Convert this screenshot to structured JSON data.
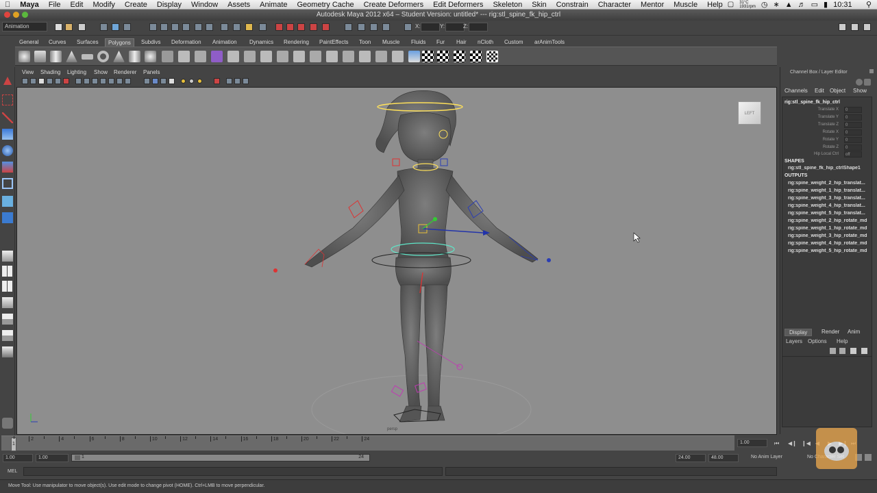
{
  "mac_menubar": {
    "app": "Maya",
    "items": [
      "File",
      "Edit",
      "Modify",
      "Create",
      "Display",
      "Window",
      "Assets",
      "Animate",
      "Geometry Cache",
      "Create Deformers",
      "Edit Deformers",
      "Skeleton",
      "Skin",
      "Constrain",
      "Character",
      "Mentor",
      "Muscle",
      "Help"
    ],
    "cpu_temp": "31°C",
    "cpu_rpm": "1931rpm",
    "clock": "Sat 10:31 AM"
  },
  "window": {
    "title": "Autodesk Maya 2012 x64 – Student Version: untitled*   ---   rig:stl_spine_fk_hip_ctrl"
  },
  "statusline": {
    "menu_set": "Animation",
    "x_label": "X:",
    "y_label": "Y:",
    "z_label": "Z:"
  },
  "shelf": {
    "tabs": [
      "General",
      "Curves",
      "Surfaces",
      "Polygons",
      "Subdivs",
      "Deformation",
      "Animation",
      "Dynamics",
      "Rendering",
      "PaintEffects",
      "Toon",
      "Muscle",
      "Fluids",
      "Fur",
      "Hair",
      "nCloth",
      "Custom",
      "arAnimTools"
    ],
    "active_tab": "Polygons"
  },
  "viewport": {
    "menu": [
      "View",
      "Shading",
      "Lighting",
      "Show",
      "Renderer",
      "Panels"
    ],
    "camera_label": "persp",
    "viewcube_label": "LEFT"
  },
  "channel_box": {
    "title": "Channel Box / Layer Editor",
    "menu": [
      "Channels",
      "Edit",
      "Object",
      "Show"
    ],
    "object_name": "rig:stl_spine_fk_hip_ctrl",
    "attributes": [
      {
        "name": "Translate X",
        "value": "0"
      },
      {
        "name": "Translate Y",
        "value": "0"
      },
      {
        "name": "Translate Z",
        "value": "0"
      },
      {
        "name": "Rotate X",
        "value": "0"
      },
      {
        "name": "Rotate Y",
        "value": "0"
      },
      {
        "name": "Rotate Z",
        "value": "0"
      },
      {
        "name": "Hip Local Ctrl",
        "value": "off"
      }
    ],
    "shapes_header": "SHAPES",
    "shapes": [
      "rig:stl_spine_fk_hip_ctrlShape1"
    ],
    "outputs_header": "OUTPUTS",
    "outputs": [
      "rig:spine_weight_2_hip_translat...",
      "rig:spine_weight_1_hip_translat...",
      "rig:spine_weight_3_hip_translat...",
      "rig:spine_weight_4_hip_translat...",
      "rig:spine_weight_5_hip_translat...",
      "rig:spine_weight_2_hip_rotate_md",
      "rig:spine_weight_1_hip_rotate_md",
      "rig:spine_weight_3_hip_rotate_md",
      "rig:spine_weight_4_hip_rotate_md",
      "rig:spine_weight_5_hip_rotate_md"
    ]
  },
  "layer_editor": {
    "tabs": [
      "Display",
      "Render",
      "Anim"
    ],
    "menu": [
      "Layers",
      "Options",
      "Help"
    ]
  },
  "timeline": {
    "ticks": [
      "2",
      "4",
      "6",
      "8",
      "10",
      "12",
      "14",
      "16",
      "18",
      "20",
      "22",
      "24"
    ],
    "current_frame": "1",
    "current_time_field": "1.00"
  },
  "range": {
    "start_time": "1.00",
    "playback_start": "1.00",
    "slider_start": "1",
    "slider_end": "24",
    "playback_end": "24.00",
    "end_time": "48.00",
    "anim_layer": "No Anim Layer",
    "character_set": "No Character Set"
  },
  "mel": {
    "label": "MEL"
  },
  "helpline": {
    "text": "Move Tool: Use manipulator to move object(s). Use edit mode to change pivot (HOME).  Ctrl+LMB to move perpendicular."
  }
}
